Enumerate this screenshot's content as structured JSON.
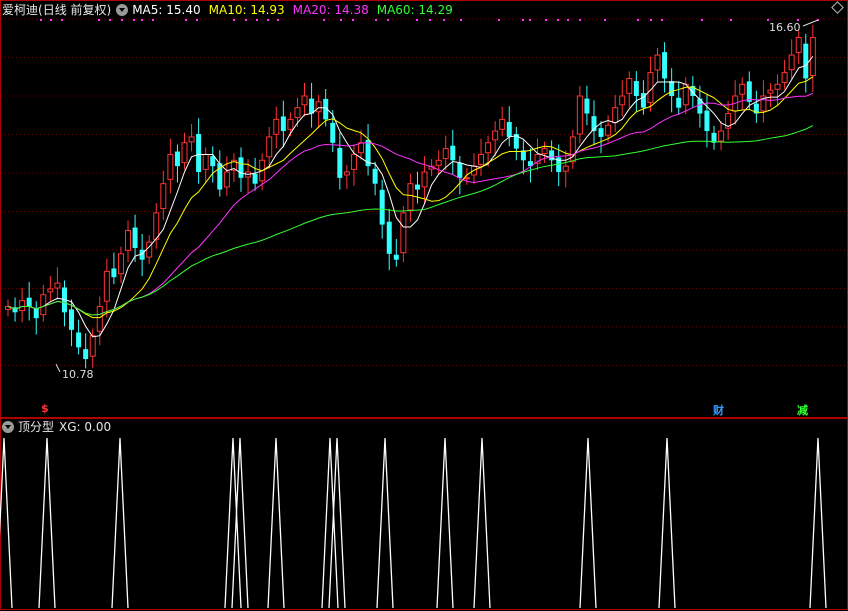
{
  "main": {
    "stock_name": "爱柯迪",
    "period_label": "(日线 前复权)",
    "ma": [
      {
        "label": "MA5: 15.40",
        "color": "#ffffff"
      },
      {
        "label": "MA10: 14.93",
        "color": "#ffff00"
      },
      {
        "label": "MA20: 14.38",
        "color": "#ff33ff"
      },
      {
        "label": "MA60: 14.29",
        "color": "#33ff33"
      }
    ],
    "high_price": "16.60",
    "low_price": "10.78",
    "markers": [
      {
        "text": "$",
        "color": "#ff3333"
      },
      {
        "text": "财",
        "color": "#3399ff"
      },
      {
        "text": "减",
        "color": "#33ff33"
      }
    ]
  },
  "indicator": {
    "label": "顶分型",
    "value": "XG: 0.00"
  },
  "colors": {
    "up": "#ff3333",
    "down": "#33ffff",
    "border": "#b00000",
    "grid": "#6a0000",
    "dots": "#ff33ff",
    "indicator_line": "#ffffff"
  },
  "chart_data": {
    "type": "candlestick",
    "price_range": [
      10.4,
      16.9
    ],
    "bars": 115,
    "closes": [
      12.0,
      11.9,
      12.1,
      12.0,
      11.8,
      12.2,
      12.3,
      12.4,
      11.9,
      11.6,
      11.3,
      11.1,
      11.5,
      12.0,
      12.6,
      12.5,
      12.9,
      13.3,
      13.0,
      12.8,
      13.1,
      13.6,
      14.1,
      14.6,
      14.4,
      14.8,
      14.9,
      14.3,
      14.6,
      14.4,
      14.0,
      14.3,
      14.5,
      14.2,
      14.3,
      14.1,
      14.5,
      14.9,
      15.2,
      15.0,
      15.2,
      15.4,
      15.6,
      15.3,
      15.5,
      15.2,
      14.8,
      14.2,
      14.3,
      14.6,
      14.8,
      14.4,
      14.1,
      13.4,
      12.9,
      12.8,
      13.6,
      14.1,
      14.0,
      14.3,
      14.4,
      14.5,
      14.7,
      14.5,
      14.2,
      14.2,
      14.4,
      14.6,
      14.8,
      15.0,
      15.2,
      14.9,
      14.7,
      14.5,
      14.4,
      14.6,
      14.7,
      14.5,
      14.3,
      14.4,
      14.9,
      15.6,
      15.3,
      15.0,
      14.9,
      15.1,
      15.4,
      15.6,
      15.9,
      15.6,
      15.4,
      16.0,
      16.3,
      15.9,
      15.6,
      15.4,
      15.8,
      15.6,
      15.3,
      15.0,
      14.8,
      15.0,
      15.3,
      15.6,
      15.8,
      15.5,
      15.3,
      15.6,
      15.7,
      15.8,
      16.0,
      16.3,
      16.6,
      15.9,
      16.6
    ],
    "ma": [
      {
        "name": "MA5",
        "value": 15.4
      },
      {
        "name": "MA10",
        "value": 14.93
      },
      {
        "name": "MA20",
        "value": 14.38
      },
      {
        "name": "MA60",
        "value": 14.29
      }
    ],
    "xg_peaks": [
      4,
      47,
      120,
      233,
      240,
      276,
      330,
      337,
      385,
      445,
      482,
      588,
      667,
      818
    ]
  }
}
